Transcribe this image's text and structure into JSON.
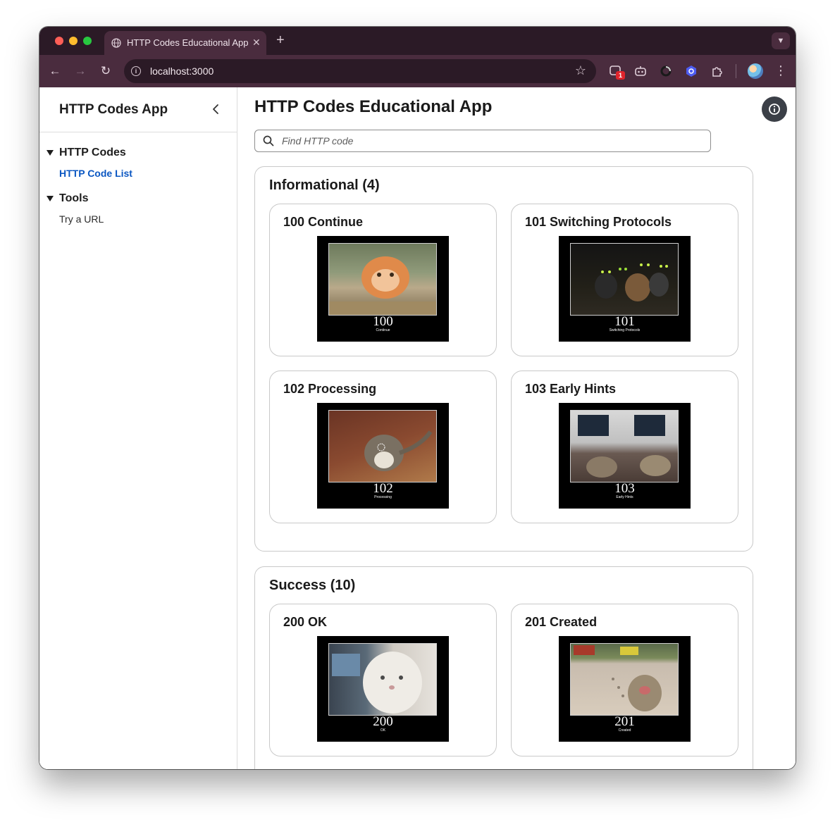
{
  "browser": {
    "tab_title": "HTTP Codes Educational App",
    "url": "localhost:3000",
    "extension_badge": "1"
  },
  "sidebar": {
    "app_title": "HTTP Codes App",
    "groups": [
      {
        "label": "HTTP Codes",
        "items": [
          {
            "label": "HTTP Code List",
            "active": true
          }
        ]
      },
      {
        "label": "Tools",
        "items": [
          {
            "label": "Try a URL",
            "active": false
          }
        ]
      }
    ]
  },
  "main": {
    "title": "HTTP Codes Educational App",
    "search": {
      "placeholder": "Find HTTP code",
      "value": ""
    },
    "sections": [
      {
        "title": "Informational (4)",
        "cards": [
          {
            "title": "100 Continue",
            "code": "100",
            "desc": "Continue"
          },
          {
            "title": "101 Switching Protocols",
            "code": "101",
            "desc": "Switching Protocols"
          },
          {
            "title": "102 Processing",
            "code": "102",
            "desc": "Processing"
          },
          {
            "title": "103 Early Hints",
            "code": "103",
            "desc": "Early Hints"
          }
        ]
      },
      {
        "title": "Success (10)",
        "cards": [
          {
            "title": "200 OK",
            "code": "200",
            "desc": "OK"
          },
          {
            "title": "201 Created",
            "code": "201",
            "desc": "Created"
          }
        ]
      }
    ]
  },
  "icons": {
    "collapse": "chevron-left-icon",
    "search": "search-icon",
    "about": "info-icon",
    "tree_caret": "caret-down-icon"
  },
  "colors": {
    "active_link": "#0b57c2",
    "browser_frame": "#2b1a26",
    "toolbar": "#4a2c3e"
  }
}
